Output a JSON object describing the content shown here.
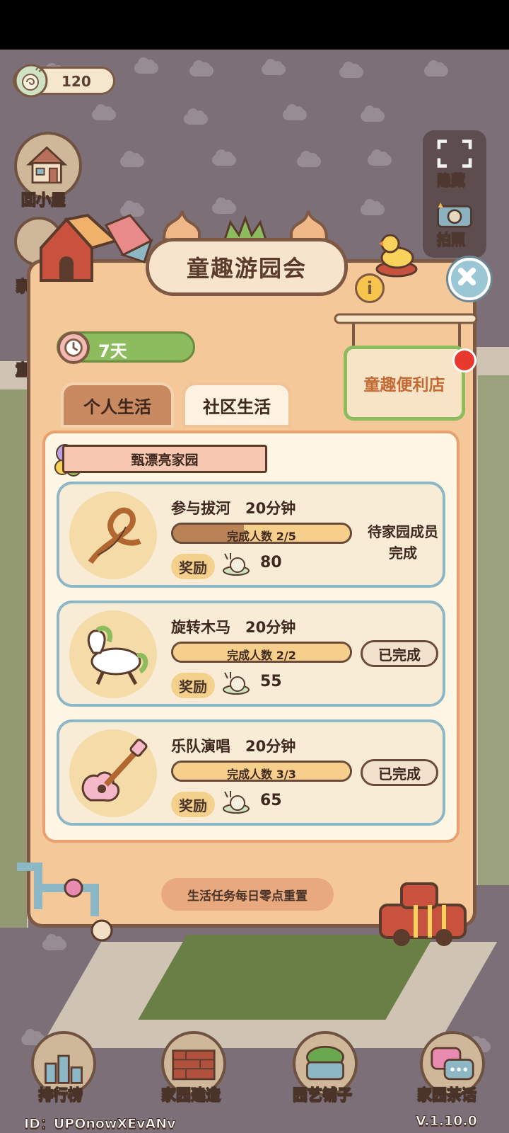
{
  "currency": {
    "amount": "120",
    "icon": "snail-icon"
  },
  "left_buttons": {
    "home": "回小屋",
    "partial": "家",
    "partial2": "童"
  },
  "right_panel": {
    "hide": "隐藏",
    "photo": "拍照"
  },
  "modal": {
    "title": "童趣游园会",
    "timer": "7天",
    "shop": "童趣便利店",
    "tabs": [
      {
        "label": "个人生活",
        "active": true
      },
      {
        "label": "社区生活",
        "active": false
      }
    ],
    "section": "甄漂亮家园",
    "reset_note": "生活任务每日零点重置",
    "tasks": [
      {
        "name": "参与拔河　20分钟",
        "progress_label": "完成人数 2/5",
        "progress": 0.4,
        "reward_label": "奖励",
        "reward": "80",
        "status_line1": "待家园成员",
        "status_line2": "完成"
      },
      {
        "name": "旋转木马　20分钟",
        "progress_label": "完成人数 2/2",
        "progress": 1.0,
        "reward_label": "奖励",
        "reward": "55",
        "status": "已完成"
      },
      {
        "name": "乐队演唱　20分钟",
        "progress_label": "完成人数 3/3",
        "progress": 1.0,
        "reward_label": "奖励",
        "reward": "65",
        "status": "已完成"
      }
    ]
  },
  "bottom_nav": [
    {
      "label": "排行榜",
      "icon": "leaderboard-icon"
    },
    {
      "label": "家园建造",
      "icon": "brick-wall-icon"
    },
    {
      "label": "园艺铺子",
      "icon": "plant-pot-icon"
    },
    {
      "label": "家园茶话",
      "icon": "chat-bubble-icon"
    }
  ],
  "footer": {
    "id": "ID：UPOnowXEvANv",
    "version": "V.1.10.0"
  },
  "colors": {
    "accent_green": "#8dbc5e",
    "panel": "#f5c89a",
    "border": "#7e5a45"
  }
}
